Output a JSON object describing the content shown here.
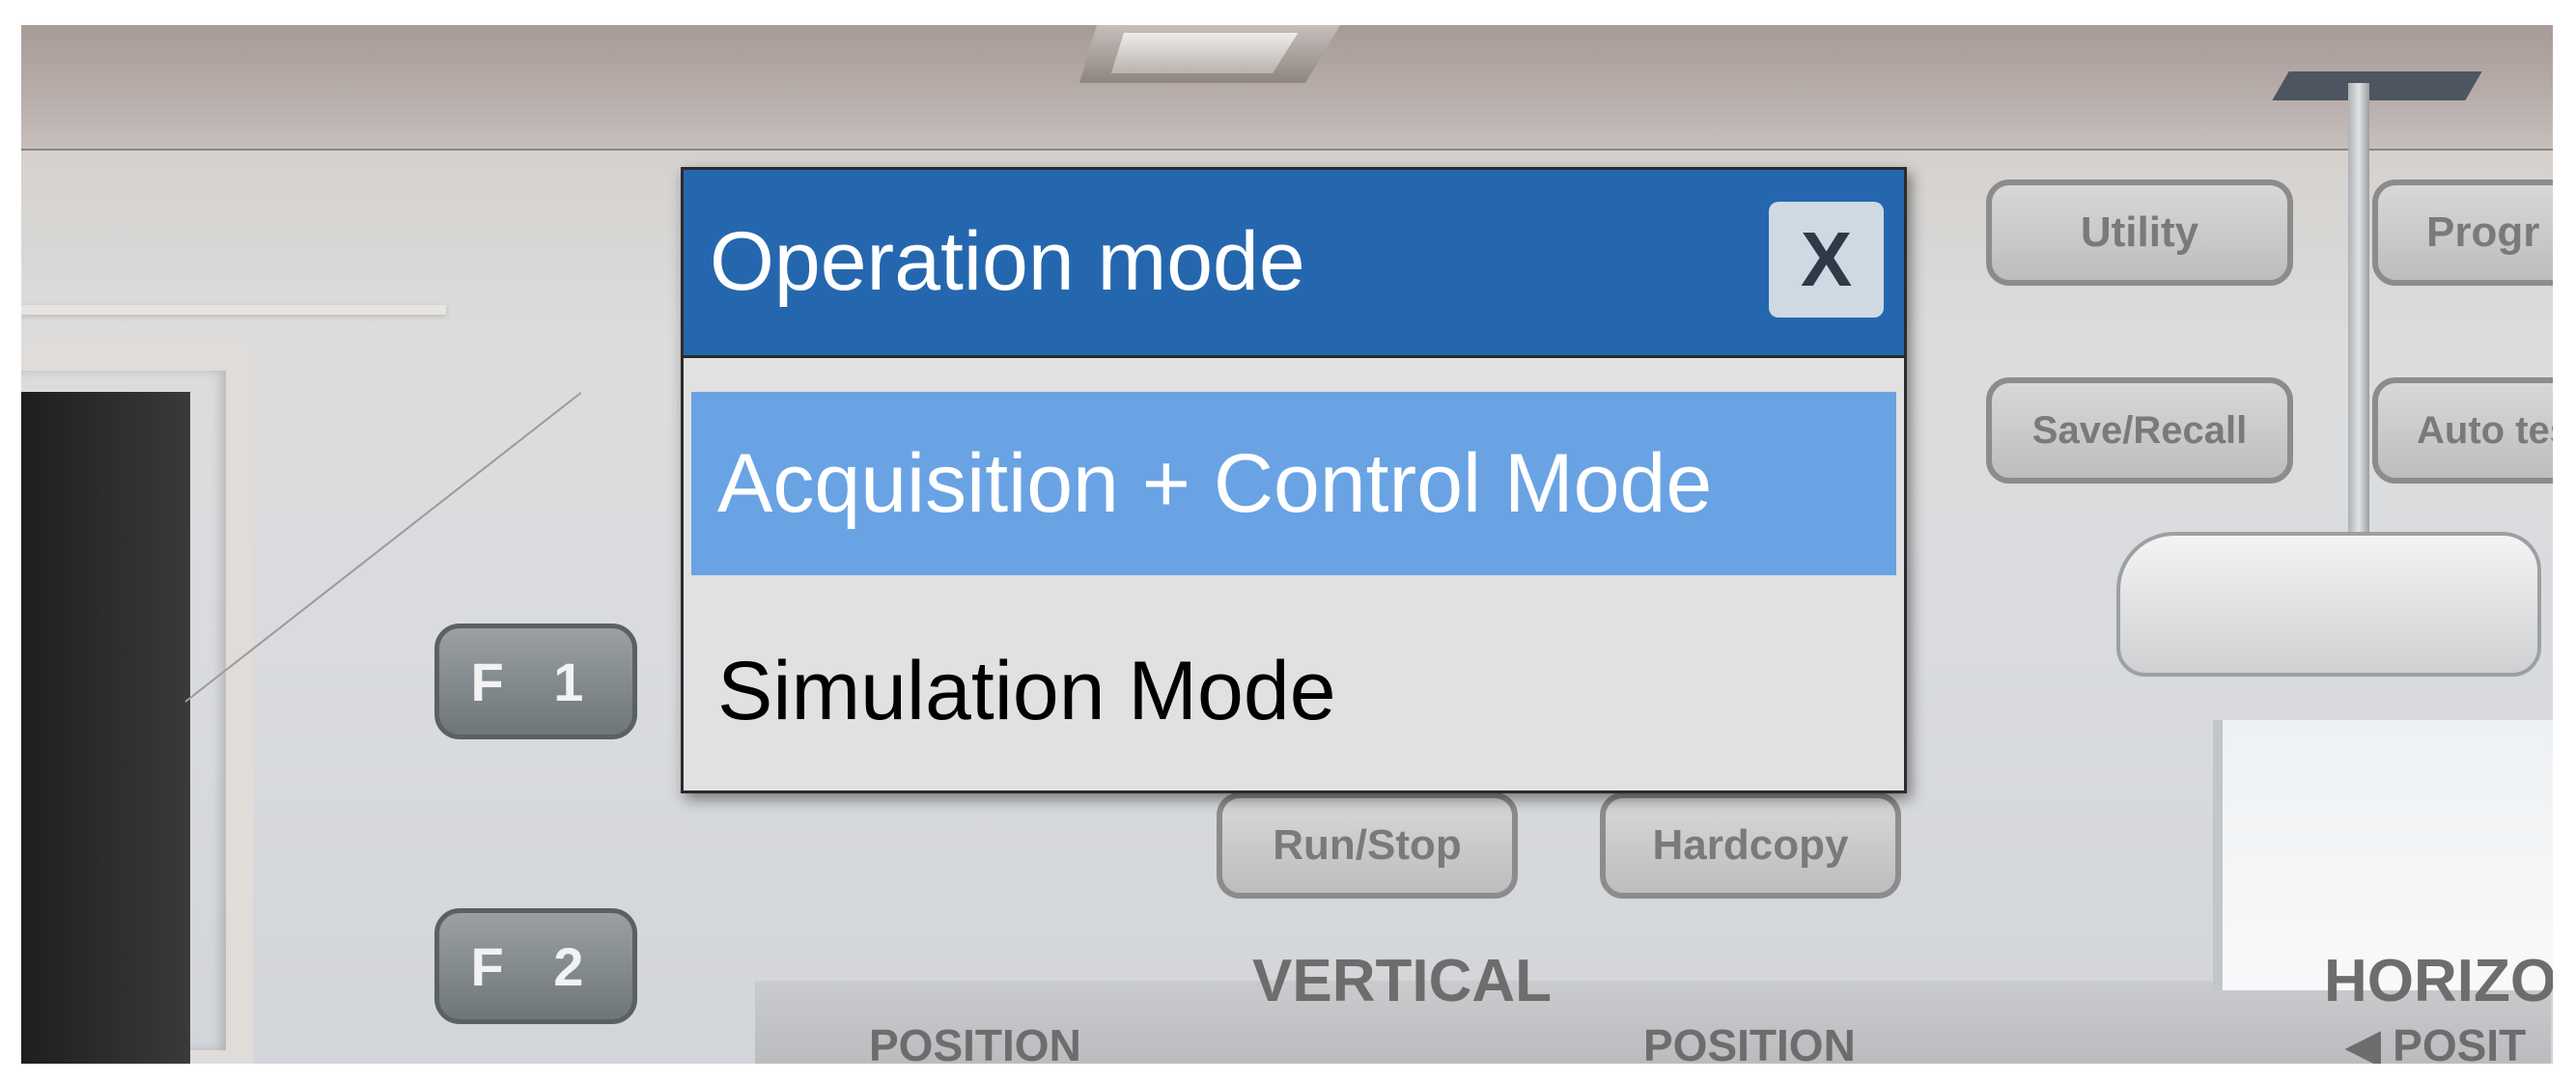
{
  "background": {
    "fkeys": [
      "F 1",
      "F 2"
    ],
    "buttons": [
      "Utility",
      "Progr",
      "Save/Recall",
      "Auto test",
      "Run/Stop",
      "Hardcopy"
    ],
    "labels": [
      "VERTICAL",
      "HORIZO",
      "POSITION",
      "POSITION",
      "◀ POSIT"
    ]
  },
  "dialog": {
    "title": "Operation mode",
    "close_label": "X",
    "options": [
      {
        "label": "Acquisition + Control Mode",
        "selected": true
      },
      {
        "label": "Simulation Mode",
        "selected": false
      }
    ]
  },
  "colors": {
    "header": "#2567ae",
    "selected_option": "#69a3e3",
    "dialog_body": "#e1e1e1",
    "close_button": "#cfd9e4"
  }
}
